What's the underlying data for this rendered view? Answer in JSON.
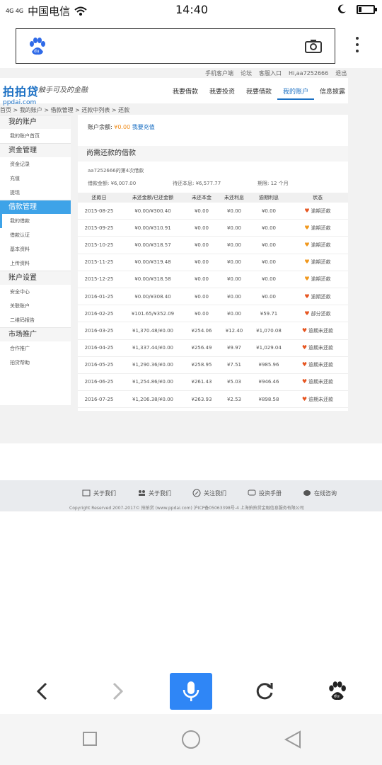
{
  "status_bar": {
    "signal": "4G 4G",
    "carrier": "中国电信",
    "time": "14:40"
  },
  "browser": {
    "search_placeholder": "",
    "search_logo": "baidu-paw-icon",
    "camera_icon": "camera-icon"
  },
  "site": {
    "top_links": [
      "手机客户端",
      "论坛",
      "客服入口",
      "Hi,aa7252666",
      "退出"
    ],
    "logo_cn": "拍拍贷",
    "logo_en": "ppdai.com",
    "slogan": "触手可及的金融",
    "main_nav": [
      "我要借款",
      "我要投资",
      "我要借款",
      "我的账户",
      "信息披露"
    ],
    "breadcrumb": "首页 > 我的账户 > 借款管理 > 还款中列表 > 还款",
    "sidebar": [
      {
        "head": "我的账户",
        "items": [
          "我的账户首页"
        ]
      },
      {
        "head": "资金管理",
        "items": [
          "资金记录",
          "充值",
          "提现"
        ]
      },
      {
        "head": "借款管理",
        "active": true,
        "items": [
          "我的借款",
          "借款认证",
          "基本资料",
          "上传资料"
        ]
      },
      {
        "head": "账户设置",
        "items": [
          "安全中心",
          "关联账户",
          "二维码报告"
        ]
      },
      {
        "head": "市场推广",
        "items": [
          "合作推广",
          "拍贷帮助"
        ]
      }
    ],
    "balance_label": "账户余额:",
    "balance_amount": "¥0.00",
    "balance_action": "我要充值",
    "section_title": "尚需还款的借款",
    "loan_id": "aa7252666的第4次借款",
    "summary": {
      "amount": "借款金额: ¥6,007.00",
      "remaining": "待还本息: ¥6,577.77",
      "term": "期限: 12 个月"
    },
    "table_headers": [
      "还款日",
      "未还金额/已还金额",
      "未还本金",
      "未还利息",
      "逾期利息",
      "状态"
    ],
    "rows": [
      {
        "date": "2015-08-25",
        "amount": "¥0.00/¥300.40",
        "principal": "¥0.00",
        "interest": "¥0.00",
        "overdue": "¥0.00",
        "status": "逾期还款",
        "color": "#e65520"
      },
      {
        "date": "2015-09-25",
        "amount": "¥0.00/¥310.91",
        "principal": "¥0.00",
        "interest": "¥0.00",
        "overdue": "¥0.00",
        "status": "逾期还款",
        "color": "#f0961a"
      },
      {
        "date": "2015-10-25",
        "amount": "¥0.00/¥318.57",
        "principal": "¥0.00",
        "interest": "¥0.00",
        "overdue": "¥0.00",
        "status": "逾期还款",
        "color": "#f0961a"
      },
      {
        "date": "2015-11-25",
        "amount": "¥0.00/¥319.48",
        "principal": "¥0.00",
        "interest": "¥0.00",
        "overdue": "¥0.00",
        "status": "逾期还款",
        "color": "#f0961a"
      },
      {
        "date": "2015-12-25",
        "amount": "¥0.00/¥318.58",
        "principal": "¥0.00",
        "interest": "¥0.00",
        "overdue": "¥0.00",
        "status": "逾期还款",
        "color": "#f0961a"
      },
      {
        "date": "2016-01-25",
        "amount": "¥0.00/¥308.40",
        "principal": "¥0.00",
        "interest": "¥0.00",
        "overdue": "¥0.00",
        "status": "逾期还款",
        "color": "#e65520"
      },
      {
        "date": "2016-02-25",
        "amount": "¥101.65/¥352.09",
        "principal": "¥0.00",
        "interest": "¥0.00",
        "overdue": "¥59.71",
        "status": "部分还款",
        "color": "#e65520"
      },
      {
        "date": "2016-03-25",
        "amount": "¥1,370.48/¥0.00",
        "principal": "¥254.06",
        "interest": "¥12.40",
        "overdue": "¥1,070.08",
        "status": "逾期未还款",
        "color": "#e65520"
      },
      {
        "date": "2016-04-25",
        "amount": "¥1,337.44/¥0.00",
        "principal": "¥256.49",
        "interest": "¥9.97",
        "overdue": "¥1,029.04",
        "status": "逾期未还款",
        "color": "#e65520"
      },
      {
        "date": "2016-05-25",
        "amount": "¥1,290.36/¥0.00",
        "principal": "¥258.95",
        "interest": "¥7.51",
        "overdue": "¥985.96",
        "status": "逾期未还款",
        "color": "#e65520"
      },
      {
        "date": "2016-06-25",
        "amount": "¥1,254.86/¥0.00",
        "principal": "¥261.43",
        "interest": "¥5.03",
        "overdue": "¥946.46",
        "status": "逾期未还款",
        "color": "#e65520"
      },
      {
        "date": "2016-07-25",
        "amount": "¥1,206.38/¥0.00",
        "principal": "¥263.93",
        "interest": "¥2.53",
        "overdue": "¥898.58",
        "status": "逾期未还款",
        "color": "#e65520"
      }
    ],
    "footer_links": [
      "关于我们",
      "关于我们",
      "关注我们",
      "投资手册",
      "在线咨询"
    ],
    "copyright": "Copyright Reserved 2007-2017© 拍拍贷 (www.ppdai.com)  沪ICP备05063398号-4  上海拍拍贷金融信息服务有限公司"
  },
  "bottom_bar": [
    "back-icon",
    "forward-icon",
    "mic-icon",
    "refresh-icon",
    "baidu-paw-icon"
  ],
  "colors": {
    "accent_blue": "#3ea3e8",
    "brand_blue": "#1a6fc3",
    "mic_blue": "#2f86f6",
    "alert_red": "#e65520",
    "alert_orange": "#f0961a"
  }
}
